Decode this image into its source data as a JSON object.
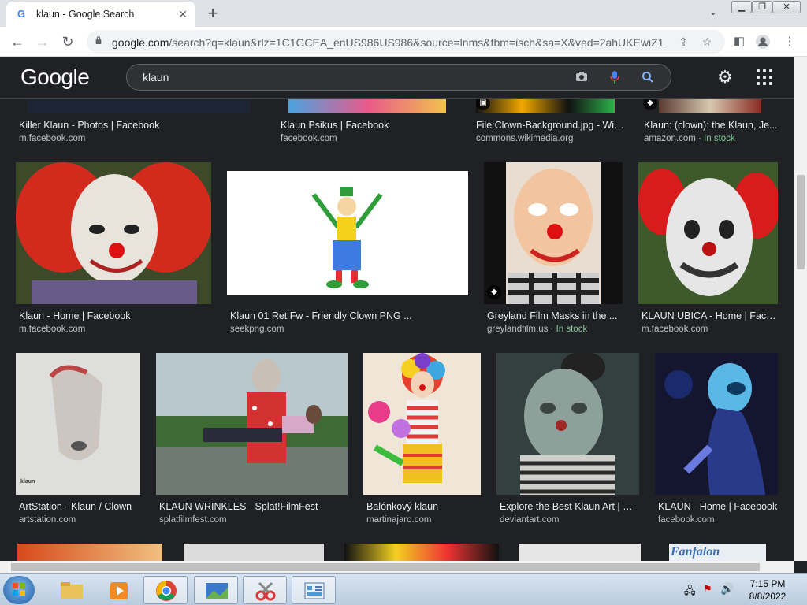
{
  "browser": {
    "tab_title": "klaun - Google Search",
    "tab_favicon": "G",
    "url_host": "google.com",
    "url_rest": "/search?q=klaun&rlz=1C1GCEA_enUS986US986&source=lnms&tbm=isch&sa=X&ved=2ahUKEwiZ1..."
  },
  "search": {
    "logo": "Google",
    "query": "klaun"
  },
  "top_row": [
    {
      "caption": "Killer Klaun - Photos | Facebook",
      "source": "m.facebook.com",
      "stock": ""
    },
    {
      "caption": "Klaun Psikus | Facebook",
      "source": "facebook.com",
      "stock": ""
    },
    {
      "caption": "File:Clown-Background.jpg - Wik...",
      "source": "commons.wikimedia.org",
      "stock": ""
    },
    {
      "caption": "Klaun: (clown): the Klaun, Je...",
      "source": "amazon.com · ",
      "stock": "In stock"
    }
  ],
  "row2": [
    {
      "caption": "Klaun - Home | Facebook",
      "source": "m.facebook.com",
      "stock": ""
    },
    {
      "caption": "Klaun 01 Ret Fw - Friendly Clown PNG ...",
      "source": "seekpng.com",
      "stock": ""
    },
    {
      "caption": "Greyland Film Masks in the ...",
      "source": "greylandfilm.us · ",
      "stock": "In stock"
    },
    {
      "caption": "KLAUN UBICA - Home | Face...",
      "source": "m.facebook.com",
      "stock": ""
    }
  ],
  "row3": [
    {
      "caption": "ArtStation - Klaun / Clown",
      "source": "artstation.com",
      "stock": ""
    },
    {
      "caption": "KLAUN WRINKLES - Splat!FilmFest",
      "source": "splatfilmfest.com",
      "stock": ""
    },
    {
      "caption": "Balónkový klaun",
      "source": "martinajaro.com",
      "stock": ""
    },
    {
      "caption": "Explore the Best Klaun Art | D...",
      "source": "deviantart.com",
      "stock": ""
    },
    {
      "caption": "KLAUN - Home | Facebook",
      "source": "facebook.com",
      "stock": ""
    }
  ],
  "thumb_texts": {
    "artstation_mark": "klaun",
    "fanfalon": "Fanfalon"
  },
  "taskbar": {
    "time": "7:15 PM",
    "date": "8/8/2022"
  },
  "colors": {
    "page_bg": "#202124",
    "caption": "#e8eaed",
    "source": "#bdc1c6",
    "in_stock": "#81c995"
  }
}
